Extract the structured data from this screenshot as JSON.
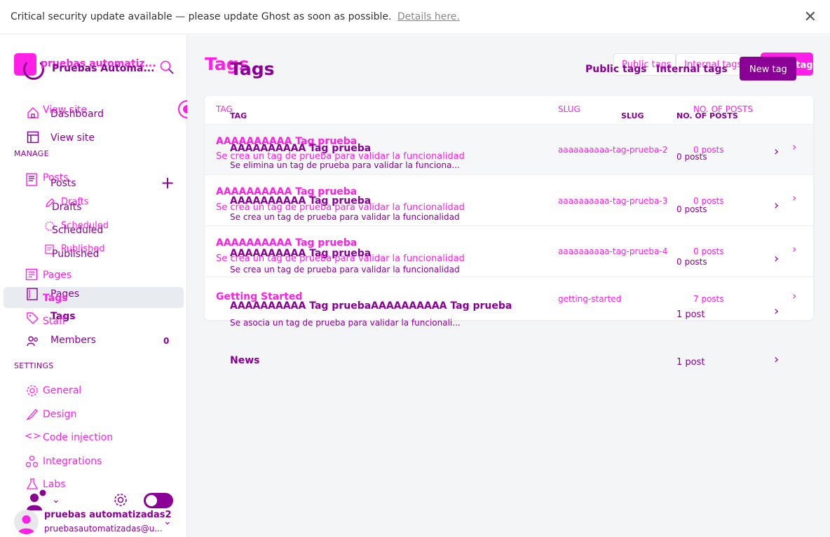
{
  "banner": {
    "text": "Critical security update available — please update Ghost as soon as possible.",
    "link": "Details here."
  },
  "sidebar": {
    "site_title_a": "pruebas automatiz...",
    "site_title_b": "Pruebas Automa...",
    "view_site_a": "View site",
    "dashboard": "Dashboard",
    "view_site_b": "View site",
    "manage_label": "MANAGE",
    "posts_a": "Posts",
    "posts_b": "Posts",
    "drafts_a": "Drafts",
    "drafts_b": "Drafts",
    "scheduled_a": "Scheduled",
    "scheduled_b": "Scheduled",
    "published_a": "Published",
    "published_b": "Published",
    "pages_a": "Pages",
    "pages_b": "Pages",
    "tags_a": "Tags",
    "tags_b": "Tags",
    "staff": "Staff",
    "members": "Members",
    "members_count": "0",
    "settings_label": "SETTINGS",
    "general": "General",
    "design": "Design",
    "code_injection": "Code injection",
    "integrations": "Integrations",
    "labs": "Labs",
    "user_name": "pruebas automatizadas2",
    "user_email": "pruebasautomatizadas@u..."
  },
  "header": {
    "title_a": "Tags",
    "title_b": "Tags",
    "public_tags_a": "Public tags",
    "internal_tags_a": "Internal tags",
    "public_tags_b": "Public tags",
    "internal_tags_b": "Internal tags",
    "new_tag_a": "New tag",
    "new_tag_b": "New tag"
  },
  "table": {
    "col_tag_a": "TAG",
    "col_tag_b": "TAG",
    "col_slug_a": "SLUG",
    "col_slug_b": "SLUG",
    "col_posts_a": "NO. OF POSTS",
    "col_posts_b": "NO. OF POSTS",
    "rows_a": [
      {
        "name": "AAAAAAAAAA Tag prueba",
        "desc": "Se crea un tag de prueba para validar la funcionalidad",
        "slug": "aaaaaaaaaa-tag-prueba-2",
        "posts": "0 posts"
      },
      {
        "name": "AAAAAAAAAA Tag prueba",
        "desc": "Se crea un tag de prueba para validar la funcionalidad",
        "slug": "aaaaaaaaaa-tag-prueba-3",
        "posts": "0 posts"
      },
      {
        "name": "AAAAAAAAAA Tag prueba",
        "desc": "Se crea un tag de prueba para validar la funcionalidad",
        "slug": "aaaaaaaaaa-tag-prueba-4",
        "posts": "0 posts"
      },
      {
        "name": "Getting Started",
        "desc": "",
        "slug": "getting-started",
        "posts": "7 posts"
      }
    ],
    "rows_b": [
      {
        "name": "AAAAAAAAAA Tag prueba",
        "desc": "Se elimina un tag de prueba para validar la funciona...",
        "posts": "0 posts"
      },
      {
        "name": "AAAAAAAAAA Tag prueba",
        "desc": "Se crea un tag de prueba para validar la funcionalidad",
        "posts": "0 posts"
      },
      {
        "name": "AAAAAAAAAA Tag prueba",
        "desc": "Se crea un tag de prueba para validar la funcionalidad",
        "posts": "0 posts"
      },
      {
        "name": "AAAAAAAAAA Tag pruebaAAAAAAAAAA Tag prueba",
        "desc": "Se asocia un tag de prueba para validar la funcionali...",
        "posts": "1 post"
      },
      {
        "name": "News",
        "desc": "",
        "posts": "1 post"
      }
    ]
  },
  "colors": {
    "magenta": "#ff1fe6",
    "purple": "#8a0096"
  }
}
